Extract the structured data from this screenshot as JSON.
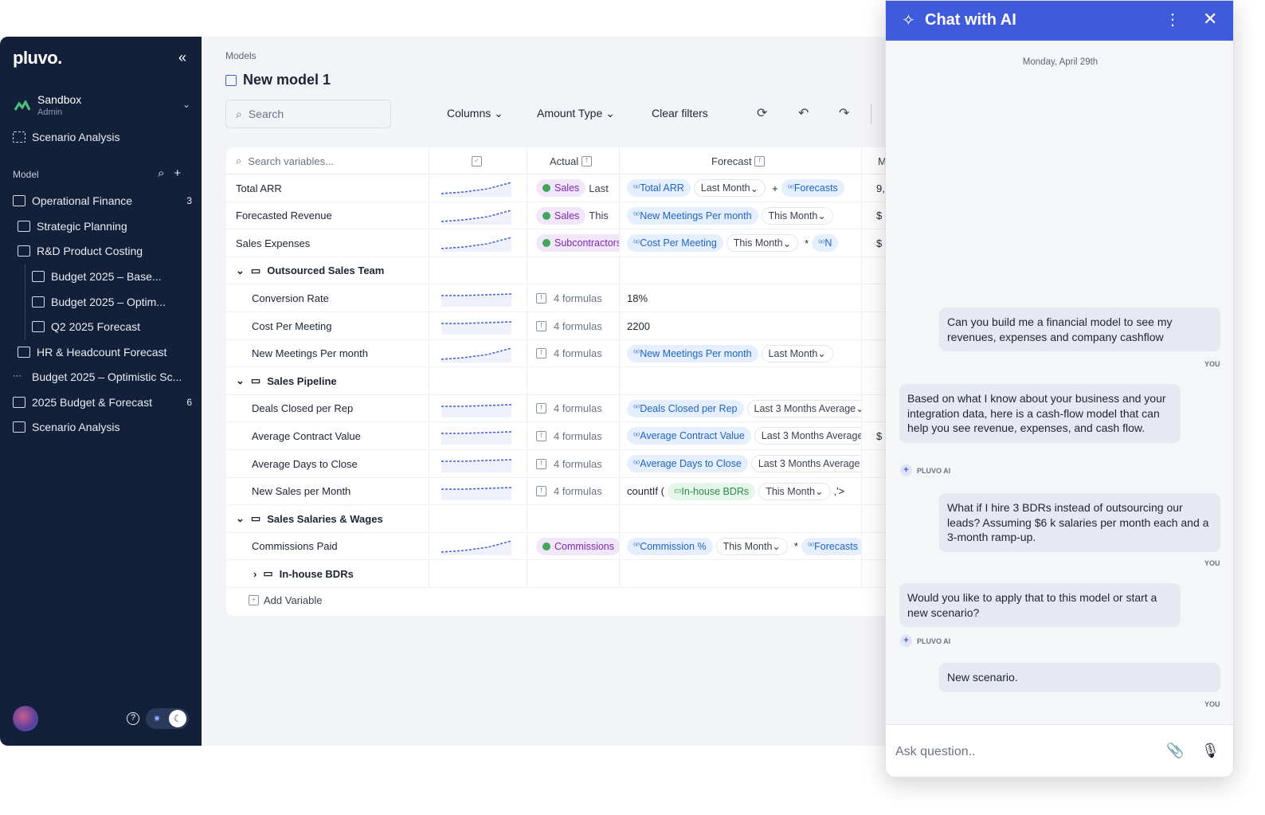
{
  "sidebar": {
    "logo": "pluvo.",
    "workspace": {
      "name": "Sandbox",
      "role": "Admin"
    },
    "top_item": "Scenario Analysis",
    "section": "Model",
    "items": [
      {
        "label": "Operational Finance",
        "count": "3"
      },
      {
        "label": "Strategic Planning",
        "count": ""
      },
      {
        "label": "R&D Product Costing",
        "count": ""
      },
      {
        "label": "Budget 2025 – Base...",
        "count": ""
      },
      {
        "label": "Budget 2025 – Optim...",
        "count": ""
      },
      {
        "label": "Q2 2025 Forecast",
        "count": ""
      },
      {
        "label": "HR & Headcount Forecast",
        "count": ""
      },
      {
        "label": "Budget 2025 – Optimistic Sc...",
        "count": ""
      },
      {
        "label": "2025 Budget & Forecast",
        "count": "6"
      },
      {
        "label": "Scenario Analysis",
        "count": ""
      }
    ]
  },
  "main": {
    "breadcrumb": "Models",
    "title": "New model 1",
    "search_placeholder": "Search",
    "toolbar": {
      "columns": "Columns",
      "amount_type": "Amount Type",
      "clear": "Clear filters"
    },
    "grid": {
      "search_placeholder": "Search variables...",
      "headers": {
        "actual": "Actual",
        "forecast": "Forecast",
        "more": "M"
      },
      "rows": [
        {
          "name": "Total ARR",
          "actual": "Sales",
          "actual_extra": "Last",
          "forecast": [
            "Total ARR",
            "Last Month",
            "Forecasts"
          ],
          "op": "+",
          "last": "9,"
        },
        {
          "name": "Forecasted Revenue",
          "actual": "Sales",
          "actual_extra": "This",
          "forecast": [
            "New Meetings Per month",
            "This Month"
          ],
          "last": "$"
        },
        {
          "name": "Sales Expenses",
          "actual": "Subcontractors",
          "actual_extra": "",
          "forecast": [
            "Cost Per Meeting",
            "This Month",
            "N"
          ],
          "op": "*",
          "last": "$"
        },
        {
          "group": "Outsourced Sales Team"
        },
        {
          "name": "Conversion Rate",
          "formulas": "4 formulas",
          "value": "18%"
        },
        {
          "name": "Cost Per Meeting",
          "formulas": "4 formulas",
          "value": "2200"
        },
        {
          "name": "New Meetings Per month",
          "formulas": "4 formulas",
          "forecast": [
            "New Meetings Per month",
            "Last Month"
          ]
        },
        {
          "group": "Sales Pipeline"
        },
        {
          "name": "Deals Closed per Rep",
          "formulas": "4 formulas",
          "forecast": [
            "Deals Closed per Rep",
            "Last 3 Months Average"
          ]
        },
        {
          "name": "Average Contract Value",
          "formulas": "4 formulas",
          "forecast": [
            "Average Contract Value",
            "Last 3 Months Average"
          ],
          "last": "$"
        },
        {
          "name": "Average Days to Close",
          "formulas": "4 formulas",
          "forecast": [
            "Average Days to Close",
            "Last 3 Months Average"
          ]
        },
        {
          "name": "New Sales per Month",
          "formulas": "4 formulas",
          "countif": "countIf (",
          "forecast": [
            "In-house BDRs",
            "This Month"
          ],
          "tail": ",'>"
        },
        {
          "group": "Sales Salaries & Wages"
        },
        {
          "name": "Commissions Paid",
          "actual": "Commissions",
          "forecast": [
            "Commission %",
            "This Month",
            "Forecasts"
          ],
          "op": "*"
        },
        {
          "subgroup": "In-house BDRs"
        }
      ],
      "add_variable": "Add Variable"
    }
  },
  "chat": {
    "title": "Chat with AI",
    "date": "Monday, April 29th",
    "you": "YOU",
    "ai_label": "PLUVO AI",
    "messages": [
      "Can you build me a financial model to see my revenues, expenses and company cashflow",
      "Based on what I know about your business and your integration data, here is a cash-flow model that can help you see revenue, expenses, and cash flow.",
      "What if I hire 3 BDRs instead of outsourcing our leads? Assuming $6 k salaries per month each and a 3-month ramp-up.",
      "Would you like to apply that to this model or start a new scenario?",
      "New scenario."
    ],
    "input_placeholder": "Ask question.."
  }
}
